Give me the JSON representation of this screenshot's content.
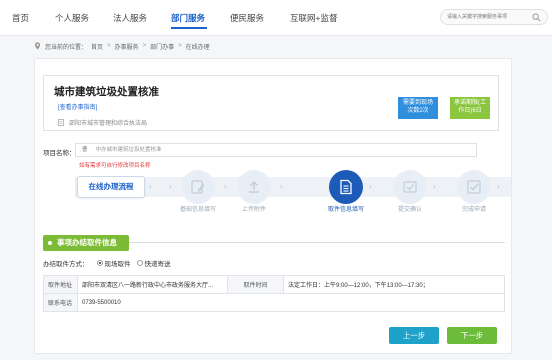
{
  "nav": {
    "items": [
      "首页",
      "个人服务",
      "法人服务",
      "部门服务",
      "便民服务",
      "互联网+监督"
    ],
    "active_index": 3,
    "search_placeholder": "请输入关键字搜索服务事项"
  },
  "breadcrumb": {
    "prefix": "您当前的位置：",
    "items": [
      "首页",
      "办事服务",
      "部门办事",
      "在线办理"
    ],
    "separator": ">"
  },
  "item": {
    "title": "城市建筑垃圾处置核准",
    "guide_link": "[查看办事指南]",
    "department": "邵阳市城市管理和综合执法局",
    "badge_blue": "需要到现场\n次数2次",
    "badge_green": "承诺期限(工\n作日)6日"
  },
  "project": {
    "label": "项目名称：",
    "value_label": "曹",
    "value": "中办城市建筑垃圾处置核准",
    "hint": "如有需求可自行修改项目名称"
  },
  "steps": {
    "label": "在线办理流程",
    "items": [
      {
        "label": "基础信息填写",
        "icon": "edit-icon"
      },
      {
        "label": "上传附件",
        "icon": "upload-icon"
      },
      {
        "label": "取件信息填写",
        "icon": "document-icon"
      },
      {
        "label": "提交确认",
        "icon": "submit-icon"
      },
      {
        "label": "完成申请",
        "icon": "check-icon"
      }
    ],
    "active_index": 2
  },
  "section": {
    "title": "事项办结取件信息",
    "method_label": "办结取件方式：",
    "options": [
      "现场取件",
      "快递寄送"
    ],
    "selected_option": 0
  },
  "table": {
    "address_label": "取件地址",
    "address_value": "邵阳市双清区八一路新行政中心市政务服务大厅...",
    "time_label": "取件时间",
    "time_value": "法定工作日：上午9:00—12:00，下午13:00—17:30；",
    "phone_label": "联系电话",
    "phone_value": "0739-5500010"
  },
  "buttons": {
    "prev": "上一步",
    "next": "下一步"
  },
  "colors": {
    "primary": "#1d62c9",
    "active_step": "#1d5bb8",
    "section_green": "#7cbb35",
    "hint_red": "#e03b3b",
    "prev_button": "#1fa2c9",
    "next_button": "#6dbb3a"
  }
}
